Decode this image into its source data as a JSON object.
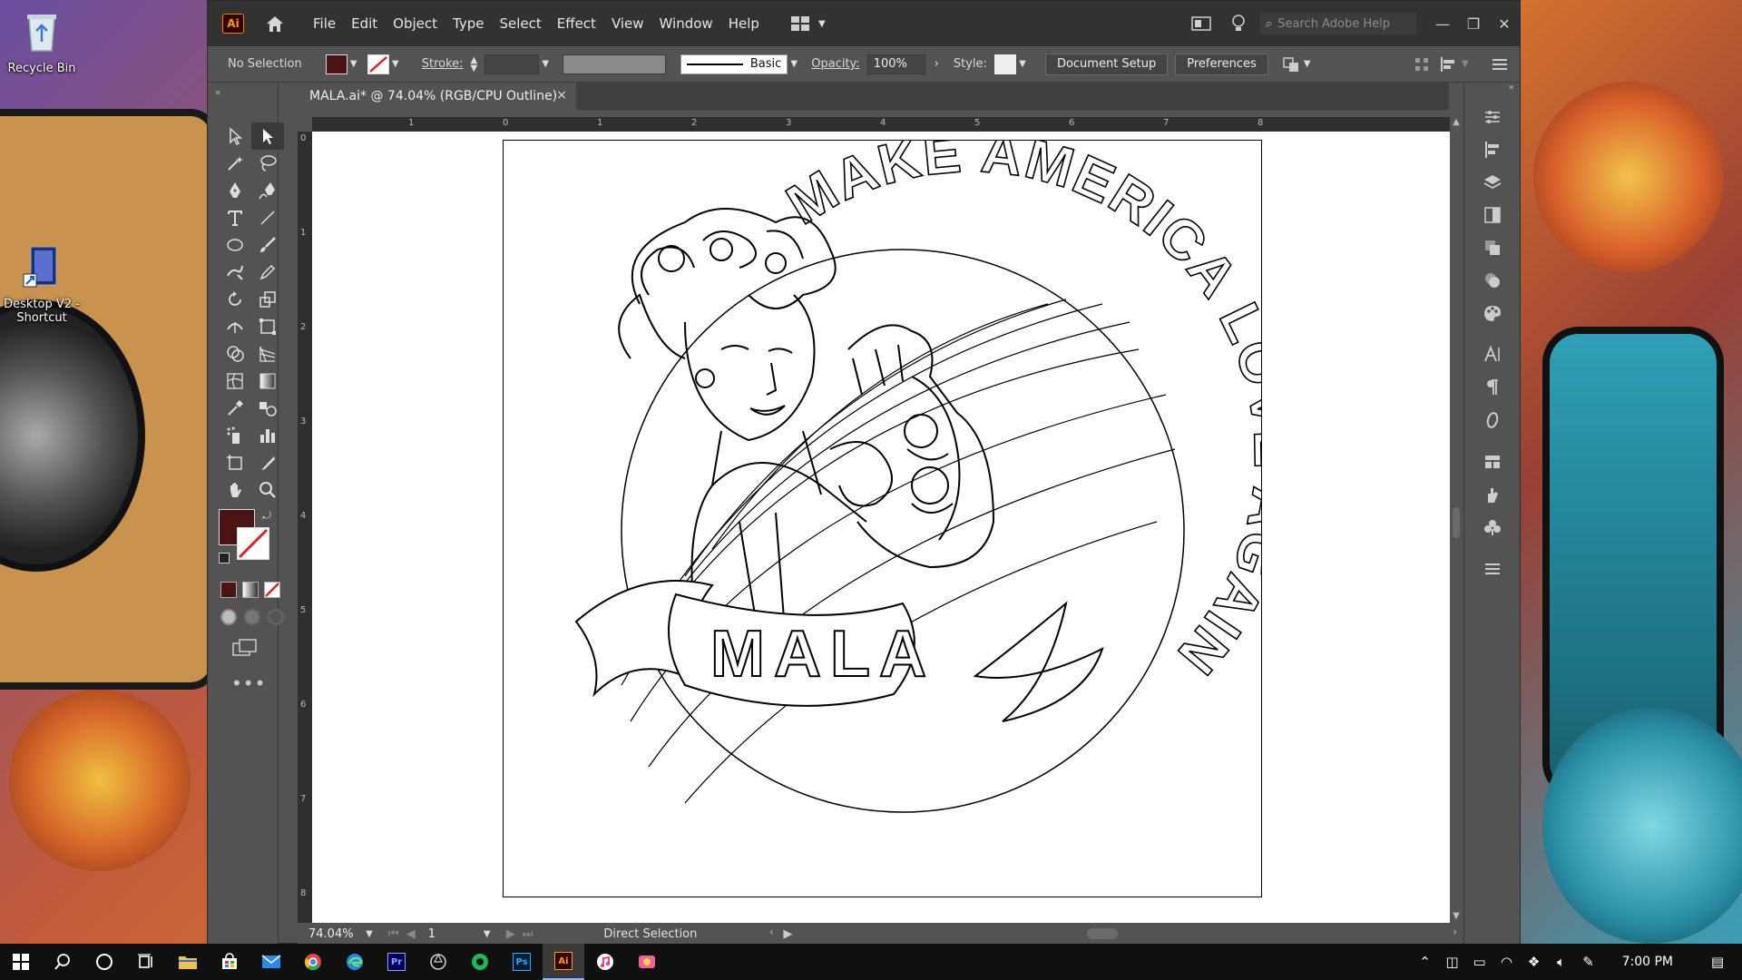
{
  "desktop": {
    "icons": [
      {
        "label": "Recycle Bin"
      },
      {
        "label": "Desktop V2 - Shortcut"
      }
    ]
  },
  "app": {
    "logo": "Ai",
    "menu": [
      "File",
      "Edit",
      "Object",
      "Type",
      "Select",
      "Effect",
      "View",
      "Window",
      "Help"
    ],
    "search_placeholder": "Search Adobe Help"
  },
  "controlbar": {
    "selection": "No Selection",
    "stroke_label": "Stroke:",
    "brush": "Basic",
    "opacity_label": "Opacity:",
    "opacity_value": "100%",
    "style_label": "Style:",
    "document_setup": "Document Setup",
    "preferences": "Preferences"
  },
  "document": {
    "tab_title": "MALA.ai* @ 74.04% (RGB/CPU Outline)",
    "close_glyph": "×",
    "art_text": "MAKE AMERICA LOVE AGAIN",
    "banner_text": "MALA",
    "fill_color": "#4a1414"
  },
  "rulers": {
    "top": [
      "1",
      "0",
      "1",
      "2",
      "3",
      "4",
      "5",
      "6",
      "7",
      "8"
    ],
    "left": [
      "0",
      "1",
      "2",
      "3",
      "4",
      "5",
      "6",
      "7",
      "8"
    ]
  },
  "statusbar": {
    "zoom": "74.04%",
    "artboard_number": "1",
    "tool_name": "Direct Selection"
  },
  "taskbar": {
    "time": "7:00 PM"
  }
}
